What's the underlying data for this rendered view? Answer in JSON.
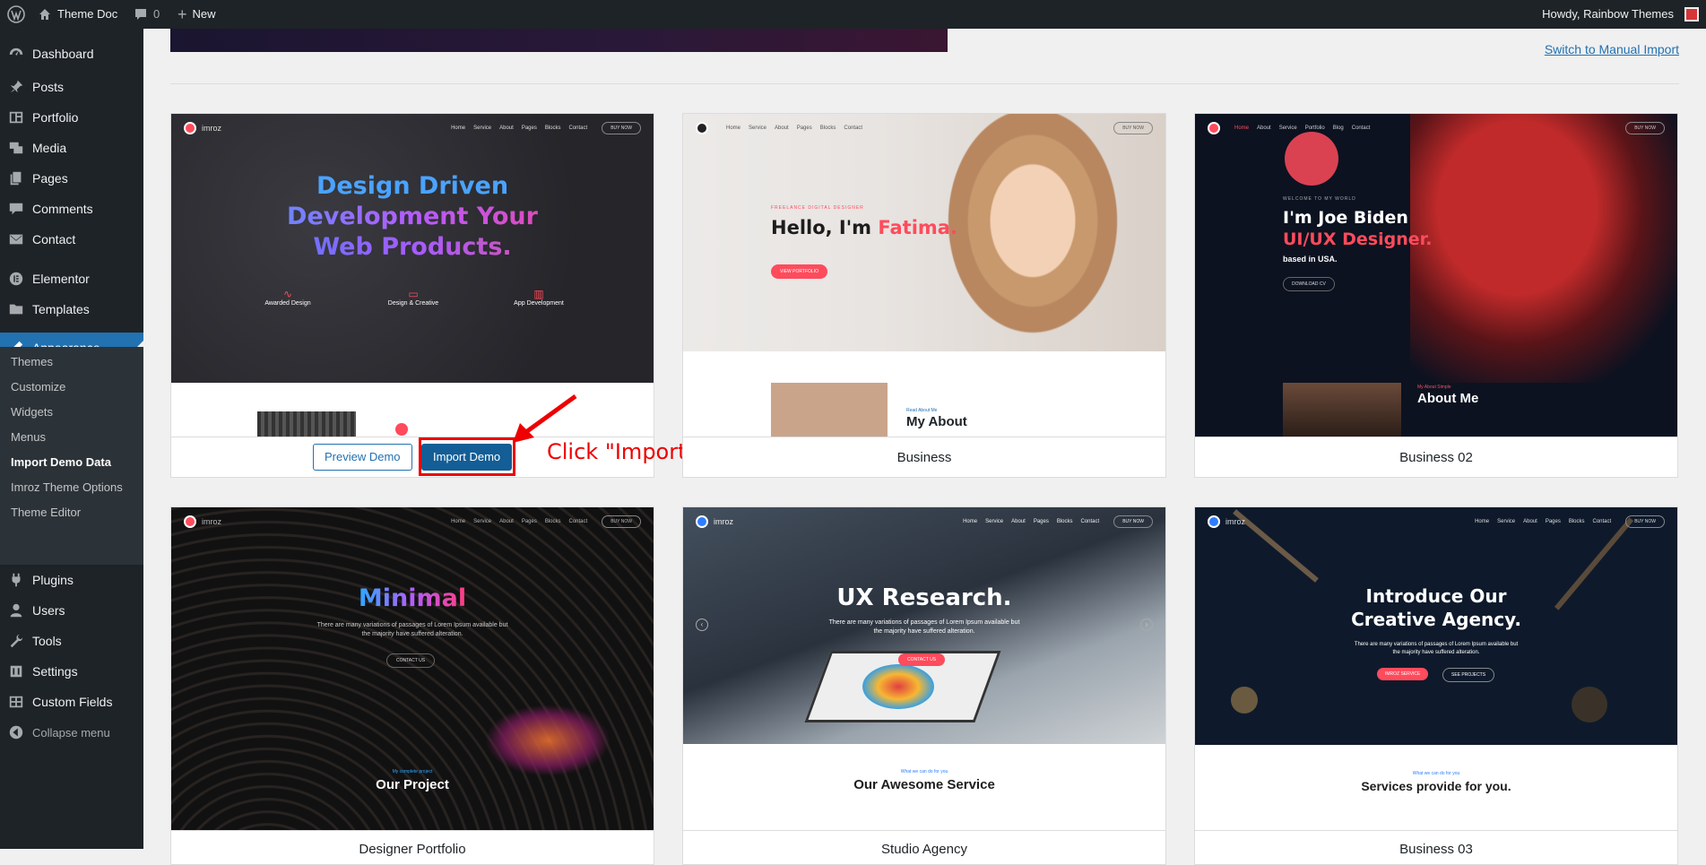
{
  "adminbar": {
    "site_name": "Theme Doc",
    "comments_count": "0",
    "new_label": "New",
    "howdy": "Howdy, Rainbow Themes"
  },
  "sidebar": {
    "items": [
      {
        "label": "Dashboard",
        "icon": "dashboard-icon"
      },
      {
        "label": "Posts",
        "icon": "pin-icon"
      },
      {
        "label": "Portfolio",
        "icon": "portfolio-icon"
      },
      {
        "label": "Media",
        "icon": "media-icon"
      },
      {
        "label": "Pages",
        "icon": "pages-icon"
      },
      {
        "label": "Comments",
        "icon": "comments-icon"
      },
      {
        "label": "Contact",
        "icon": "mail-icon"
      },
      {
        "label": "Elementor",
        "icon": "elementor-icon"
      },
      {
        "label": "Templates",
        "icon": "folder-icon"
      },
      {
        "label": "Appearance",
        "icon": "brush-icon"
      },
      {
        "label": "Plugins",
        "icon": "plug-icon"
      },
      {
        "label": "Users",
        "icon": "users-icon"
      },
      {
        "label": "Tools",
        "icon": "wrench-icon"
      },
      {
        "label": "Settings",
        "icon": "settings-icon"
      },
      {
        "label": "Custom Fields",
        "icon": "grid-icon"
      },
      {
        "label": "Collapse menu",
        "icon": "collapse-icon"
      }
    ],
    "submenu": [
      "Themes",
      "Customize",
      "Widgets",
      "Menus",
      "Import Demo Data",
      "Imroz Theme Options",
      "Theme Editor"
    ]
  },
  "content": {
    "manual_import_link": "Switch to Manual Import",
    "preview_label": "Preview Demo",
    "import_label": "Import Demo",
    "annotation": "Click \"Import Demo\" button",
    "cards": [
      {
        "title": "",
        "headline_1": "Design Driven",
        "headline_2": "Development Your",
        "headline_3": "Web Products.",
        "features": [
          "Awarded Design",
          "Design & Creative",
          "App Development"
        ]
      },
      {
        "title": "Business",
        "kicker": "FREELANCE DIGITAL DESIGNER",
        "hello": "Hello, I'm ",
        "name": "Fatima.",
        "cta": "VIEW PORTFOLIO",
        "about_kicker": "Read About Me",
        "about_title": "My About"
      },
      {
        "title": "Business 02",
        "kicker": "WELCOME TO MY WORLD",
        "line1": "I'm Joe Biden",
        "line2": "UI/UX Designer.",
        "line3": "based in USA.",
        "cta": "DOWNLOAD CV",
        "about_kicker": "My About Simple",
        "about_title": "About Me"
      },
      {
        "title": "Designer Portfolio",
        "headline": "Minimal",
        "sub": "There are many variations of passages of Lorem Ipsum available but the majority have suffered alteration.",
        "cta": "CONTACT US",
        "section_kicker": "My complete project",
        "section_title": "Our Project"
      },
      {
        "title": "Studio Agency",
        "headline": "UX Research.",
        "sub": "There are many variations of passages of Lorem Ipsum available but the majority have suffered alteration.",
        "cta": "CONTACT US",
        "section_kicker": "What we can do for you",
        "section_title": "Our Awesome Service"
      },
      {
        "title": "Business 03",
        "headline_1": "Introduce Our",
        "headline_2": "Creative Agency.",
        "sub": "There are many variations of passages of Lorem Ipsum available but the majority have suffered alteration.",
        "cta1": "IMROZ SERVICE",
        "cta2": "SEE PROJECTS",
        "section_kicker": "What we can do for you",
        "section_title": "Services provide for you."
      }
    ],
    "mock_nav": {
      "brand": "imroz",
      "links_a": [
        "Home",
        "Service",
        "About",
        "Pages",
        "Blocks",
        "Contact"
      ],
      "links_b": [
        "Home",
        "About",
        "Service",
        "Portfolio",
        "Blog",
        "Contact"
      ],
      "links_c": [
        "Home",
        "Service",
        "About",
        "Pages",
        "Blocks",
        "Contact"
      ],
      "buy": "BUY NOW"
    }
  },
  "colors": {
    "admin_dark": "#1d2327",
    "accent_blue": "#2271b1",
    "button_blue": "#135e96",
    "annotation_red": "#ee0000",
    "brand_pink": "#ff4b5c"
  }
}
